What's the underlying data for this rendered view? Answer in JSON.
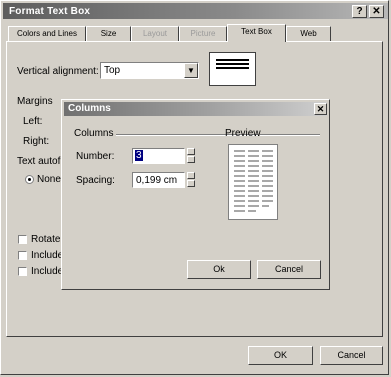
{
  "window": {
    "title": "Format Text Box",
    "help_label": "?",
    "close_label": "✕"
  },
  "tabs": [
    {
      "label": "Colors and Lines",
      "state": "normal"
    },
    {
      "label": "Size",
      "state": "normal"
    },
    {
      "label": "Layout",
      "state": "disabled"
    },
    {
      "label": "Picture",
      "state": "disabled"
    },
    {
      "label": "Text Box",
      "state": "active"
    },
    {
      "label": "Web",
      "state": "normal"
    }
  ],
  "textbox_tab": {
    "vertical_alignment_label": "Vertical alignment:",
    "vertical_alignment_value": "Top",
    "margins_label": "Margins",
    "left_label": "Left:",
    "right_label": "Right:",
    "text_autofit_label": "Text autofit",
    "none_label": "None",
    "rotate_label": "Rotate",
    "include_label_1": "Include",
    "include_label_2": "Include"
  },
  "columns_dialog": {
    "title": "Columns",
    "close_label": "✕",
    "group_label": "Columns",
    "number_label": "Number:",
    "number_value": "3",
    "spacing_label": "Spacing:",
    "spacing_value": "0,199 cm",
    "preview_label": "Preview",
    "ok_label": "Ok",
    "cancel_label": "Cancel"
  },
  "footer": {
    "ok_label": "OK",
    "cancel_label": "Cancel"
  }
}
